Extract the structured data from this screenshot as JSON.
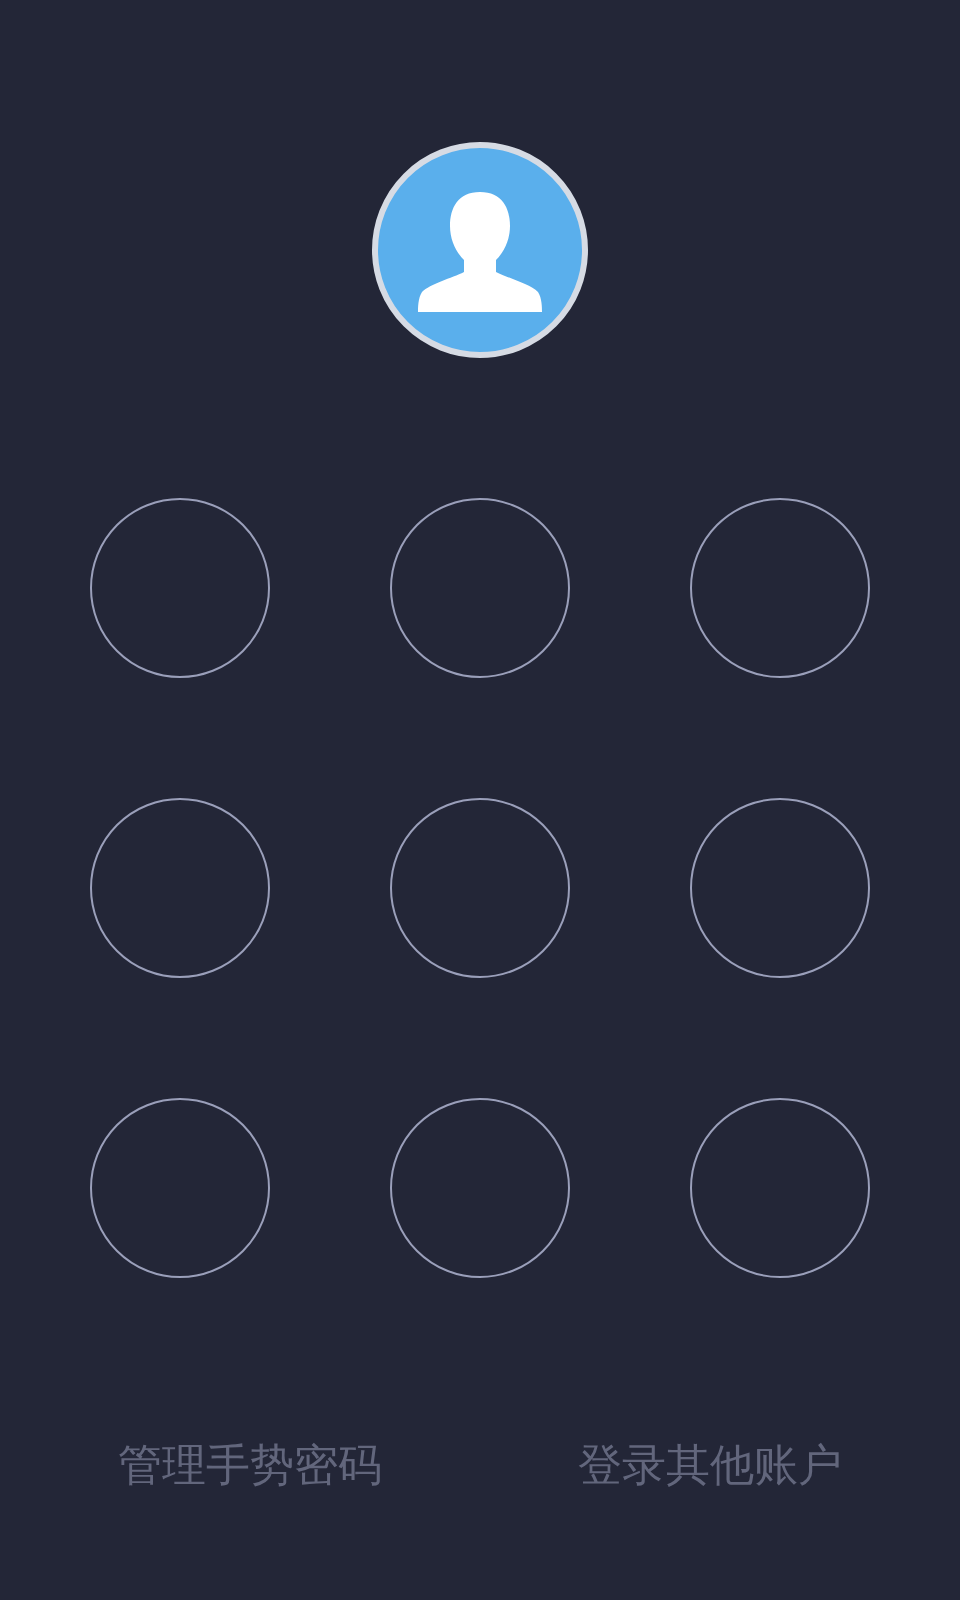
{
  "avatar": {
    "kind": "person"
  },
  "pattern_dots": [
    {
      "selected": false
    },
    {
      "selected": false
    },
    {
      "selected": false
    },
    {
      "selected": false
    },
    {
      "selected": false
    },
    {
      "selected": false
    },
    {
      "selected": false
    },
    {
      "selected": false
    },
    {
      "selected": false
    }
  ],
  "links": [
    "管理手势密码",
    "登录其他账户"
  ]
}
